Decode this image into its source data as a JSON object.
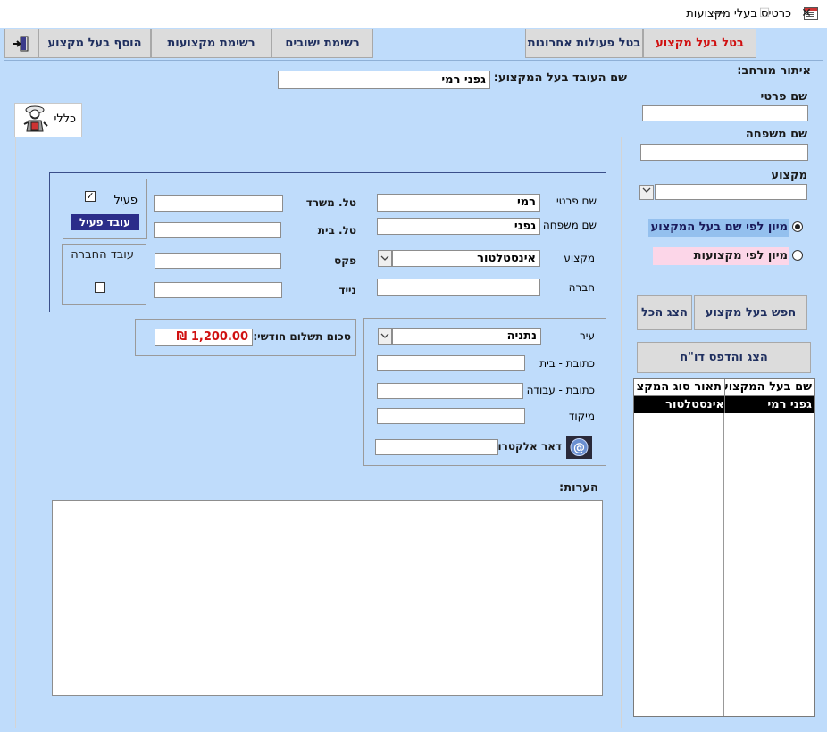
{
  "window": {
    "title": "כרטיס בעלי מקצועות",
    "min": "—",
    "max": "☐",
    "close": "✕"
  },
  "toolbar": {
    "cancel_pro": "בטל  בעל מקצוע",
    "undo_recent": "בטל פעולות אחרונות",
    "settlements_list": "רשימת ישובים",
    "professions_list": "רשימת מקצועות",
    "add_pro": "הוסף בעל מקצוע",
    "exit_icon": "exit-door-icon"
  },
  "search": {
    "heading": "איתור מורחב:",
    "first_name_label": "שם פרטי",
    "first_name_value": "",
    "last_name_label": "שם משפחה",
    "last_name_value": "",
    "profession_label": "מקצוע",
    "profession_value": "",
    "sort_by_name": "מיון לפי שם בעל המקצוע",
    "sort_by_profession": "מיון לפי מקצועות",
    "search_button": "חפש בעל מקצוע",
    "show_all_button": "הצג הכל",
    "report_button": "הצג והדפס דו\"ח",
    "list_headers": [
      "שם בעל המקצוע",
      "תאור סוג המקצ"
    ],
    "list_rows": [
      {
        "name": "גפני רמי",
        "profession": "אינסטלטור"
      }
    ]
  },
  "header": {
    "worker_label": "שם העובד בעל המקצוע:",
    "worker_value": "גפני רמי"
  },
  "tab": {
    "label": "כללי",
    "icon": "worker-icon"
  },
  "form": {
    "first_name_label": "שם פרטי",
    "first_name": "רמי",
    "last_name_label": "שם משפחה",
    "last_name": "גפני",
    "profession_label": "מקצוע",
    "profession": "אינסטלטור",
    "company_label": "חברה",
    "company": "",
    "office_phone_label": "טל. משרד",
    "office_phone": "",
    "home_phone_label": "טל. בית",
    "home_phone": "",
    "fax_label": "פקס",
    "fax": "",
    "mobile_label": "נייד",
    "mobile": "",
    "active_label": "פעיל",
    "active_checked": true,
    "active_badge": "עובד פעיל",
    "company_employee_label": "עובד החברה",
    "company_employee_checked": false,
    "monthly_payment_label": "סכום תשלום חודשי:",
    "monthly_payment": "1,200.00 ₪",
    "city_label": "עיר",
    "city": "נתניה",
    "home_address_label": "כתובת - בית",
    "home_address": "",
    "work_address_label": "כתובת - עבודה",
    "work_address": "",
    "zip_label": "מיקוד",
    "zip": "",
    "email_label": "דאר אלקטרוני",
    "email": "",
    "email_icon": "email-at-icon",
    "notes_label": "הערות:",
    "notes": ""
  }
}
